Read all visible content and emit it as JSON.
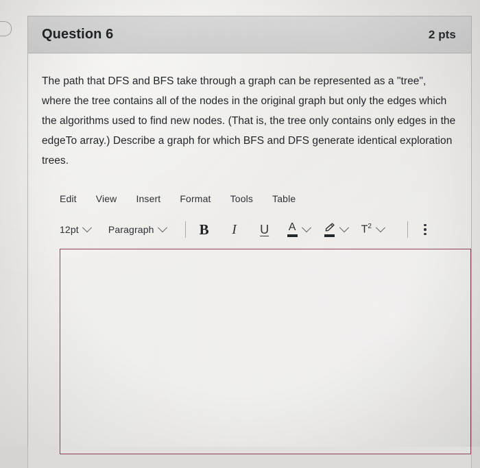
{
  "question": {
    "title": "Question 6",
    "points": "2 pts",
    "body": "The path that DFS and BFS take through a graph can be represented as a \"tree\", where the tree contains all of the nodes in the original graph but only the edges which the algorithms used to find new nodes. (That is, the tree only contains only edges in the edgeTo array.) Describe a graph for which BFS and DFS generate identical exploration trees."
  },
  "editor": {
    "menubar": [
      {
        "label": "Edit"
      },
      {
        "label": "View"
      },
      {
        "label": "Insert"
      },
      {
        "label": "Format"
      },
      {
        "label": "Tools"
      },
      {
        "label": "Table"
      }
    ],
    "toolbar": {
      "font_size": "12pt",
      "block_format": "Paragraph",
      "bold": "B",
      "italic": "I",
      "underline": "U",
      "text_color_glyph": "A",
      "highlight_glyph": "highlighter-icon",
      "superscript_glyph": "T",
      "superscript_exponent": "2",
      "more_options": "more-options-icon"
    },
    "answer_value": ""
  },
  "colors": {
    "focus_border": "#8f3f58",
    "header_bg": "#d3d3d3",
    "page_bg": "#eceae6",
    "text": "#22262a"
  }
}
